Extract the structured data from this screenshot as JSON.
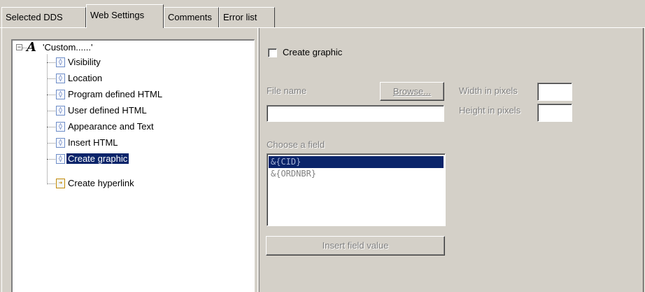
{
  "tabs": [
    {
      "label": "Selected DDS",
      "active": false
    },
    {
      "label": "Web Settings",
      "active": true
    },
    {
      "label": "Comments",
      "active": false
    },
    {
      "label": "Error list",
      "active": false
    }
  ],
  "tree": {
    "root": {
      "label": "'Custom......'",
      "icon": "font-a-icon",
      "expander": "−"
    },
    "items": [
      {
        "label": "Visibility",
        "icon": "properties-icon"
      },
      {
        "label": "Location",
        "icon": "properties-icon"
      },
      {
        "label": "Program defined HTML",
        "icon": "properties-icon"
      },
      {
        "label": "User defined HTML",
        "icon": "properties-icon"
      },
      {
        "label": "Appearance and Text",
        "icon": "properties-icon"
      },
      {
        "label": "Insert HTML",
        "icon": "properties-icon"
      },
      {
        "label": "Create graphic",
        "icon": "properties-icon",
        "selected": true
      },
      {
        "label": "Create hyperlink",
        "icon": "hyperlink-icon"
      }
    ]
  },
  "form": {
    "create_graphic_label": "Create graphic",
    "create_graphic_checked": false,
    "file_name_label": "File name",
    "file_name_value": "",
    "browse_label": "Browse...",
    "width_label": "Width in pixels",
    "width_value": "",
    "height_label": "Height in pixels",
    "height_value": "",
    "choose_field_label": "Choose a field",
    "fields": [
      "&{CID}",
      "&{ORDNBR}"
    ],
    "selected_field_index": 0,
    "insert_button_label": "Insert field value"
  },
  "colors": {
    "window_bg": "#d4d0c8",
    "selection_bg": "#0a246a",
    "disabled_text": "#808080"
  }
}
